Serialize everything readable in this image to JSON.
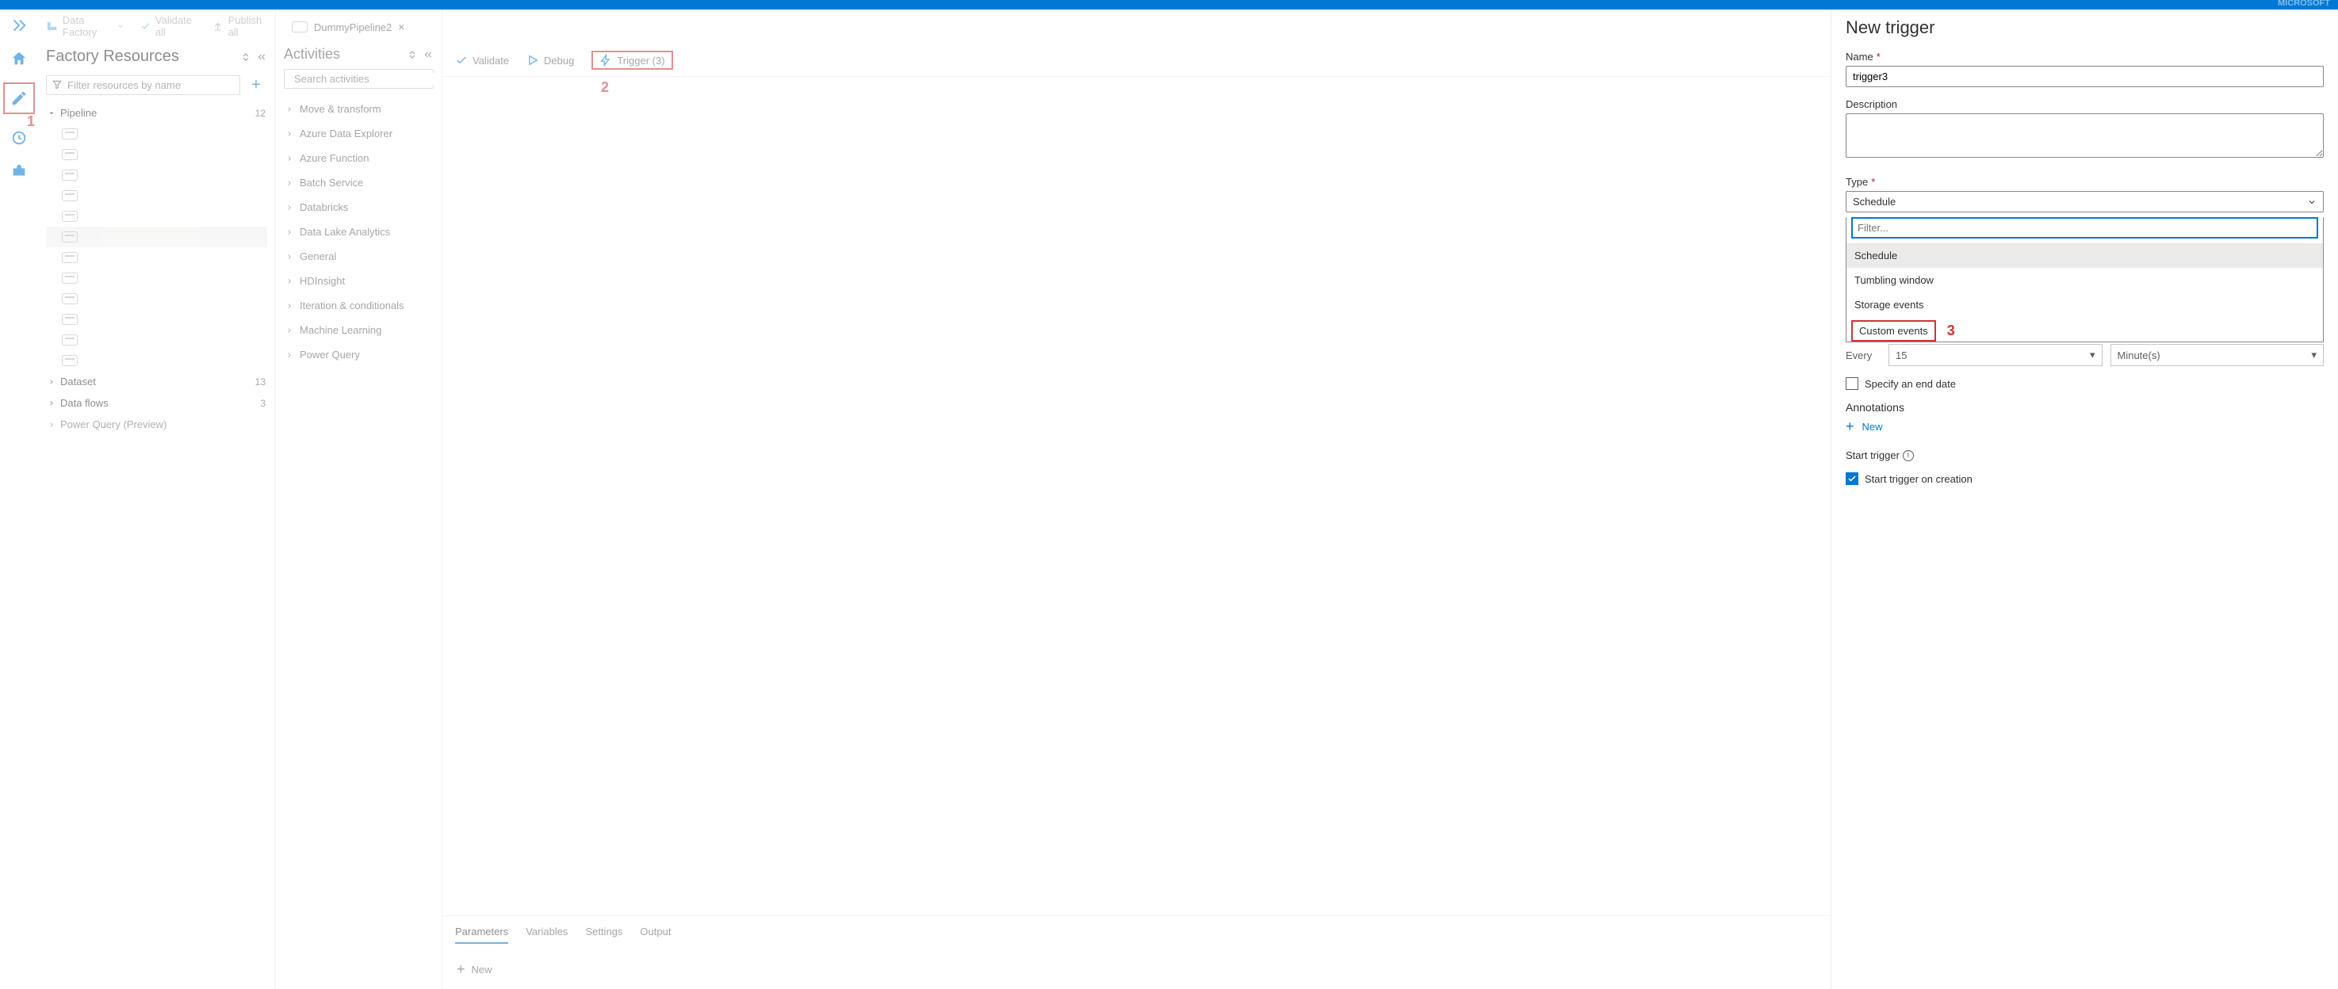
{
  "brand": "MICROSOFT",
  "top_toolbar": {
    "breadcrumb_label": "Data Factory",
    "validate_all": "Validate all",
    "publish_all": "Publish all"
  },
  "callouts": {
    "one": "1",
    "two": "2",
    "three": "3"
  },
  "resources": {
    "title": "Factory Resources",
    "filter_placeholder": "Filter resources by name",
    "pipeline_label": "Pipeline",
    "pipeline_count": "12",
    "dataset_label": "Dataset",
    "dataset_count": "13",
    "dataflows_label": "Data flows",
    "dataflows_count": "3",
    "pq_label": "Power Query (Preview)"
  },
  "activities": {
    "title": "Activities",
    "search_placeholder": "Search activities",
    "items": [
      "Move & transform",
      "Azure Data Explorer",
      "Azure Function",
      "Batch Service",
      "Databricks",
      "Data Lake Analytics",
      "General",
      "HDInsight",
      "Iteration & conditionals",
      "Machine Learning",
      "Power Query"
    ]
  },
  "canvas": {
    "tab_label": "DummyPipeline2",
    "validate": "Validate",
    "debug": "Debug",
    "trigger": "Trigger (3)",
    "bottom_tabs": [
      "Parameters",
      "Variables",
      "Settings",
      "Output"
    ],
    "new_label": "New"
  },
  "pane": {
    "title": "New trigger",
    "name_label": "Name",
    "name_value": "trigger3",
    "description_label": "Description",
    "type_label": "Type",
    "type_value": "Schedule",
    "dd_filter_placeholder": "Filter...",
    "dd_items": {
      "schedule": "Schedule",
      "tumbling": "Tumbling window",
      "storage": "Storage events",
      "custom": "Custom events"
    },
    "every_label": "Every",
    "every_value": "15",
    "every_unit": "Minute(s)",
    "specify_end": "Specify an end date",
    "annotations_label": "Annotations",
    "new_annotation": "New",
    "start_trigger_label": "Start trigger",
    "start_trigger_check": "Start trigger on creation"
  }
}
